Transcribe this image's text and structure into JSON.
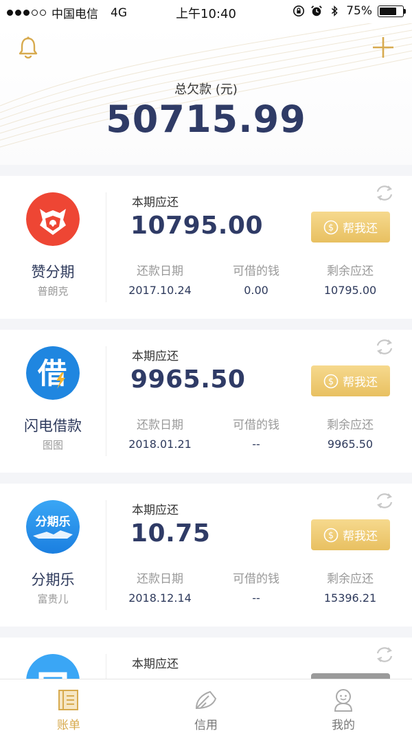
{
  "status_bar": {
    "carrier": "中国电信",
    "network": "4G",
    "time": "上午10:40",
    "battery": "75%",
    "battery_level": 0.75
  },
  "header": {
    "bell_icon": "bell-icon",
    "add_icon": "plus-icon",
    "total_label": "总欠款 (元)",
    "total_value": "50715.99"
  },
  "colors": {
    "primary_text": "#2f3b66",
    "accent_gold": "#e8c061",
    "muted": "#999999"
  },
  "cards": [
    {
      "name": "赞分期",
      "sub": "普朗克",
      "logo": "lion-logo",
      "title": "本期应还",
      "amount": "10795.00",
      "button": "帮我还",
      "due_label": "还款日期",
      "due_value": "2017.10.24",
      "borrow_label": "可借的钱",
      "borrow_value": "0.00",
      "remain_label": "剩余应还",
      "remain_value": "10795.00"
    },
    {
      "name": "闪电借款",
      "sub": "图图",
      "logo": "lightning-loan-logo",
      "logo_text": "借",
      "title": "本期应还",
      "amount": "9965.50",
      "button": "帮我还",
      "due_label": "还款日期",
      "due_value": "2018.01.21",
      "borrow_label": "可借的钱",
      "borrow_value": "--",
      "remain_label": "剩余应还",
      "remain_value": "9965.50"
    },
    {
      "name": "分期乐",
      "sub": "富贵儿",
      "logo": "fenqile-logo",
      "logo_text": "分期乐",
      "title": "本期应还",
      "amount": "10.75",
      "button": "帮我还",
      "due_label": "还款日期",
      "due_value": "2018.12.14",
      "borrow_label": "可借的钱",
      "borrow_value": "--",
      "remain_label": "剩余应还",
      "remain_value": "15396.21"
    },
    {
      "title": "本期应还"
    }
  ],
  "tabs": [
    {
      "label": "账单",
      "icon": "bill-icon",
      "active": true
    },
    {
      "label": "信用",
      "icon": "credit-icon",
      "active": false
    },
    {
      "label": "我的",
      "icon": "profile-icon",
      "active": false
    }
  ]
}
